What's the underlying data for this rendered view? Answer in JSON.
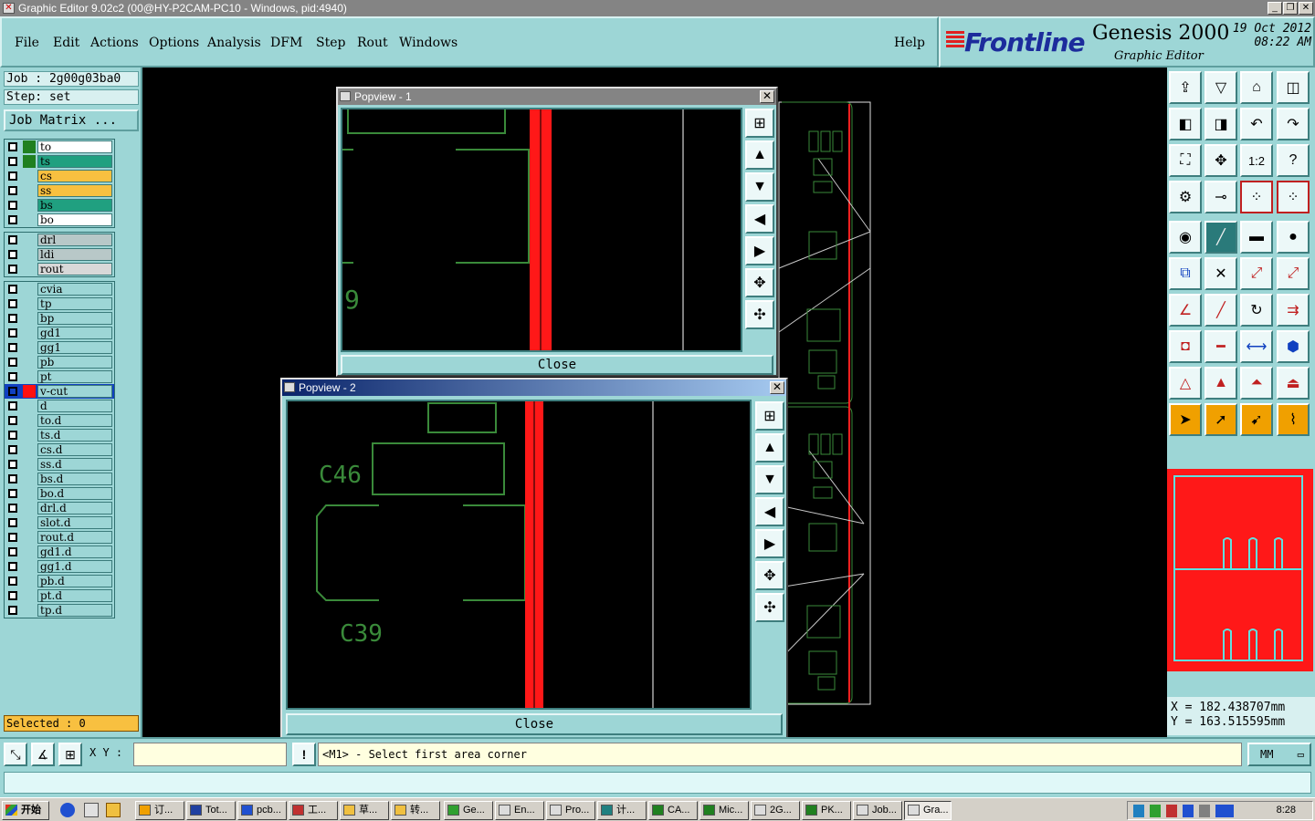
{
  "window": {
    "title": "Graphic Editor 9.02c2 (00@HY-P2CAM-PC10 - Windows, pid:4940)"
  },
  "menu": {
    "items": [
      "File",
      "Edit",
      "Actions",
      "Options",
      "Analysis",
      "DFM",
      "Step",
      "Rout",
      "Windows"
    ],
    "help": "Help"
  },
  "brand": {
    "logo": "Frontline",
    "product": "Genesis 2000",
    "subtitle": "Graphic Editor",
    "date": "19 Oct 2012",
    "time": "08:22 AM"
  },
  "job": {
    "job_label": "Job : 2g00g03ba0",
    "step_label": "Step: set",
    "matrix_button": "Job Matrix ..."
  },
  "layers": {
    "group1": [
      {
        "name": "to",
        "color": "#ffffff",
        "swatch": "#208020"
      },
      {
        "name": "ts",
        "color": "#20a080",
        "swatch": "#208020"
      },
      {
        "name": "cs",
        "color": "#f8c040",
        "swatch": ""
      },
      {
        "name": "ss",
        "color": "#f8c040",
        "swatch": ""
      },
      {
        "name": "bs",
        "color": "#20a080",
        "swatch": ""
      },
      {
        "name": "bo",
        "color": "#ffffff",
        "swatch": ""
      }
    ],
    "group2": [
      {
        "name": "drl",
        "color": "#b8c8c8",
        "swatch": ""
      },
      {
        "name": "ldi",
        "color": "#b8c8c8",
        "swatch": ""
      },
      {
        "name": "rout",
        "color": "#d8d8d8",
        "swatch": ""
      }
    ],
    "group3": [
      {
        "name": "cvia"
      },
      {
        "name": "tp"
      },
      {
        "name": "bp"
      },
      {
        "name": "gd1"
      },
      {
        "name": "gg1"
      },
      {
        "name": "pb"
      },
      {
        "name": "pt"
      },
      {
        "name": "v-cut",
        "active": true
      },
      {
        "name": "d"
      },
      {
        "name": "to.d"
      },
      {
        "name": "ts.d"
      },
      {
        "name": "cs.d"
      },
      {
        "name": "ss.d"
      },
      {
        "name": "bs.d"
      },
      {
        "name": "bo.d"
      },
      {
        "name": "drl.d"
      },
      {
        "name": "slot.d"
      },
      {
        "name": "rout.d"
      },
      {
        "name": "gd1.d"
      },
      {
        "name": "gg1.d"
      },
      {
        "name": "pb.d"
      },
      {
        "name": "pt.d"
      },
      {
        "name": "tp.d"
      }
    ]
  },
  "selected": "Selected : 0",
  "popview1": {
    "title": "Popview - 1",
    "close": "Close",
    "label": "9"
  },
  "popview2": {
    "title": "Popview - 2",
    "close": "Close",
    "labels": [
      "C46",
      "C39"
    ]
  },
  "coords": {
    "x": "X = 182.438707mm",
    "y": "Y = 163.515595mm"
  },
  "statusbar": {
    "xy_label": "X Y :",
    "xy_value": "",
    "prompt": "<M1> - Select first area corner",
    "units": "MM"
  },
  "taskbar": {
    "start": "开始",
    "tasks": [
      "订...",
      "Tot...",
      "pcb...",
      "工...",
      "草...",
      "转...",
      "Ge...",
      "En...",
      "Pro...",
      "计...",
      "CA...",
      "Mic...",
      "2G...",
      "PK...",
      "Job...",
      "Gra..."
    ],
    "clock": "8:28"
  },
  "icons": {
    "right_tools": [
      "zoom-home-icon",
      "fit-icon",
      "home-icon",
      "split-icon",
      "pan-left-icon",
      "pan-right-icon",
      "undo-zoom-icon",
      "redo-zoom-icon",
      "zoom-fit-icon",
      "zoom-center-icon",
      "ratio-icon",
      "help-icon",
      "measure-icon",
      "snap-icon",
      "nets-icon",
      "nets-alt-icon"
    ]
  }
}
